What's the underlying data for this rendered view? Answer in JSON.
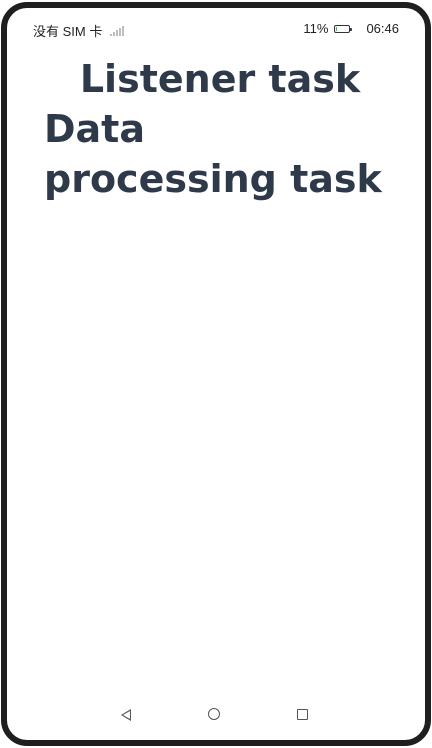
{
  "status_bar": {
    "carrier": "没有 SIM 卡",
    "battery_percent": "11%",
    "battery_level": 0.11,
    "time": "06:46",
    "battery_color": "#4caf50"
  },
  "content": {
    "listener_text": "Listener task",
    "processing_text": "Data processing task",
    "text_color": "#2e3a4a"
  },
  "nav_bar": {
    "back": "back-icon",
    "home": "home-icon",
    "recents": "recents-icon"
  }
}
